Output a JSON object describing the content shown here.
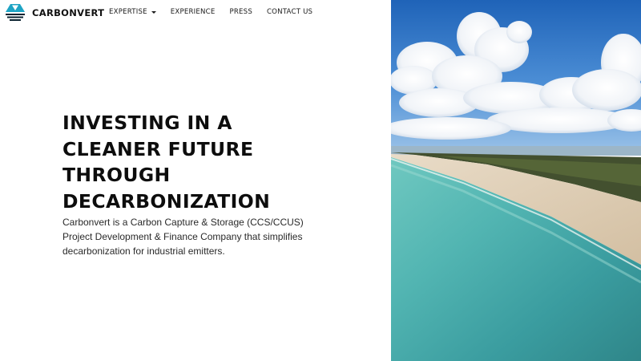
{
  "brand": {
    "name": "CARBONVERT",
    "colors": {
      "logo_primary": "#1ea4c4",
      "logo_dark": "#0b2230"
    }
  },
  "nav": {
    "items": [
      {
        "label": "EXPERTISE",
        "has_dropdown": true
      },
      {
        "label": "EXPERIENCE",
        "has_dropdown": false
      },
      {
        "label": "PRESS",
        "has_dropdown": false
      },
      {
        "label": "CONTACT US",
        "has_dropdown": false
      }
    ]
  },
  "hero": {
    "heading_lines": [
      "INVESTING IN A",
      "CLEANER FUTURE",
      "THROUGH",
      "DECARBONIZATION"
    ],
    "description": "Carbonvert is a Carbon Capture & Storage (CCS/CCUS) Project Development & Finance Company that simplifies decarbonization for industrial emitters."
  },
  "image": {
    "subject": "aerial view of a beach shoreline with turquoise water under a cloudy blue sky"
  }
}
